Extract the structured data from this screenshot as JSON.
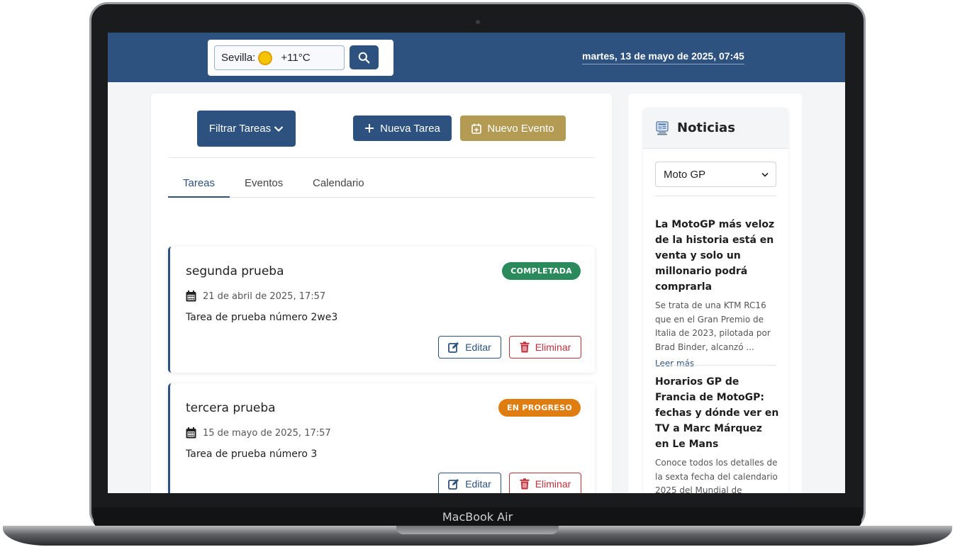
{
  "device": {
    "brand_label": "MacBook Air"
  },
  "header": {
    "weather": {
      "city": "Sevilla:",
      "icon": "sun-icon",
      "temperature": "+11°C"
    },
    "search_icon": "search-icon",
    "datetime": "martes, 13 de mayo de 2025, 07:45"
  },
  "toolbar": {
    "filter_label": "Filtrar Tareas",
    "new_task_label": "Nueva Tarea",
    "new_event_label": "Nuevo Evento"
  },
  "tabs": [
    {
      "label": "Tareas",
      "active": true
    },
    {
      "label": "Eventos",
      "active": false
    },
    {
      "label": "Calendario",
      "active": false
    }
  ],
  "tasks": [
    {
      "title": "segunda prueba",
      "status": "COMPLETADA",
      "status_color": "#2a8a5c",
      "date": "21 de abril de 2025, 17:57",
      "description": "Tarea de prueba número 2we3",
      "edit_label": "Editar",
      "delete_label": "Eliminar"
    },
    {
      "title": "tercera prueba",
      "status": "EN PROGRESO",
      "status_color": "#e07d10",
      "date": "15 de mayo de 2025, 17:57",
      "description": "Tarea de prueba número 3",
      "edit_label": "Editar",
      "delete_label": "Eliminar"
    }
  ],
  "news": {
    "title": "Noticias",
    "category": "Moto GP",
    "items": [
      {
        "title": "La MotoGP más veloz de la historia está en venta y solo un millonario podrá comprarla",
        "description": "Se trata de una KTM RC16 que en el Gran Premio de Italia de 2023, pilotada por Brad Binder, alcanzó ...",
        "link": "Leer más"
      },
      {
        "title": "Horarios GP de Francia de MotoGP: fechas y dónde ver en TV a Marc Márquez en Le Mans",
        "description": "Conoce todos los detalles de la sexta fecha del calendario 2025 del Mundial de motociclismo  Leer ..."
      }
    ]
  },
  "colors": {
    "primary": "#2d5280",
    "event_gold": "#b39b54",
    "danger": "#c0303b"
  }
}
